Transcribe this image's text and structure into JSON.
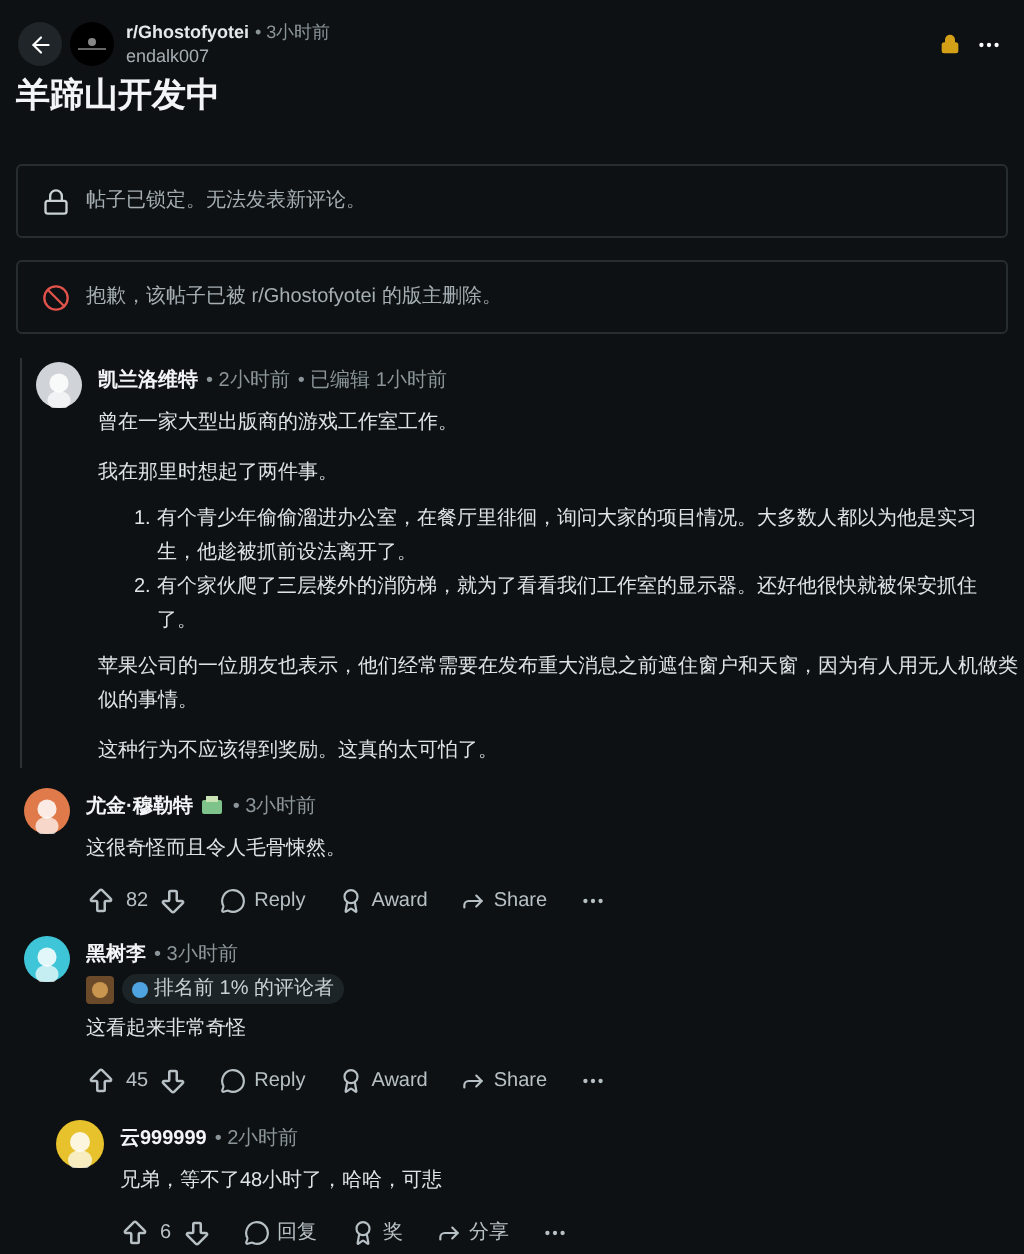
{
  "post": {
    "subreddit": "r/Ghostofyotei",
    "time": "• 3小时前",
    "author": "endalk007",
    "title": "羊蹄山开发中",
    "locked": true
  },
  "notices": [
    {
      "kind": "locked",
      "text": "帖子已锁定。无法发表新评论。"
    },
    {
      "kind": "removed",
      "text": "抱歉，该帖子已被 r/Ghostofyotei 的版主删除。"
    }
  ],
  "comments": [
    {
      "author": "凯兰洛维特",
      "time": "• 2小时前",
      "edited": "• 已编辑 1小时前",
      "color": "#d0d4d8",
      "nested": false,
      "thread_line": true,
      "body": [
        {
          "kind": "p",
          "text": "曾在一家大型出版商的游戏工作室工作。"
        },
        {
          "kind": "p",
          "text": "我在那里时想起了两件事。"
        },
        {
          "kind": "ol",
          "items": [
            {
              "number": "1.",
              "text": "有个青少年偷偷溜进办公室，在餐厅里徘徊，询问大家的项目情况。大多数人都以为他是实习生，他趁被抓前设法离开了。"
            },
            {
              "number": "2.",
              "text": "有个家伙爬了三层楼外的消防梯，就为了看看我们工作室的显示器。还好他很快就被保安抓住了。"
            }
          ]
        },
        {
          "kind": "p",
          "text": "苹果公司的一位朋友也表示，他们经常需要在发布重大消息之前遮住窗户和天窗，因为有人用无人机做类似的事情。"
        },
        {
          "kind": "p",
          "text": "这种行为不应该得到奖励。这真的太可怕了。"
        }
      ]
    },
    {
      "author": "尤金·穆勒特",
      "time": "• 3小时前",
      "color": "#e07a4a",
      "nested": false,
      "name_flair": true,
      "body": [
        {
          "kind": "p",
          "text": "这很奇怪而且令人毛骨悚然。"
        }
      ],
      "score": "82",
      "actions": [
        {
          "kind": "reply",
          "label": "Reply"
        },
        {
          "kind": "award",
          "label": "Award"
        },
        {
          "kind": "share",
          "label": "Share"
        }
      ]
    },
    {
      "author": "黑树李",
      "time": "• 3小时前",
      "color": "#3ec6d8",
      "nested": false,
      "badge": "排名前 1% 的评论者",
      "body": [
        {
          "kind": "p",
          "text": "这看起来非常奇怪"
        }
      ],
      "score": "45",
      "actions": [
        {
          "kind": "reply",
          "label": "Reply"
        },
        {
          "kind": "award",
          "label": "Award"
        },
        {
          "kind": "share",
          "label": "Share"
        }
      ]
    },
    {
      "author": "云999999",
      "time": "• 2小时前",
      "color": "#e8c22c",
      "nested": true,
      "body": [
        {
          "kind": "p",
          "text": "兄弟，等不了48小时了，哈哈，可悲"
        }
      ],
      "score": "6",
      "actions": [
        {
          "kind": "reply",
          "label": "回复"
        },
        {
          "kind": "award",
          "label": "奖"
        },
        {
          "kind": "share",
          "label": "分享"
        }
      ]
    }
  ]
}
